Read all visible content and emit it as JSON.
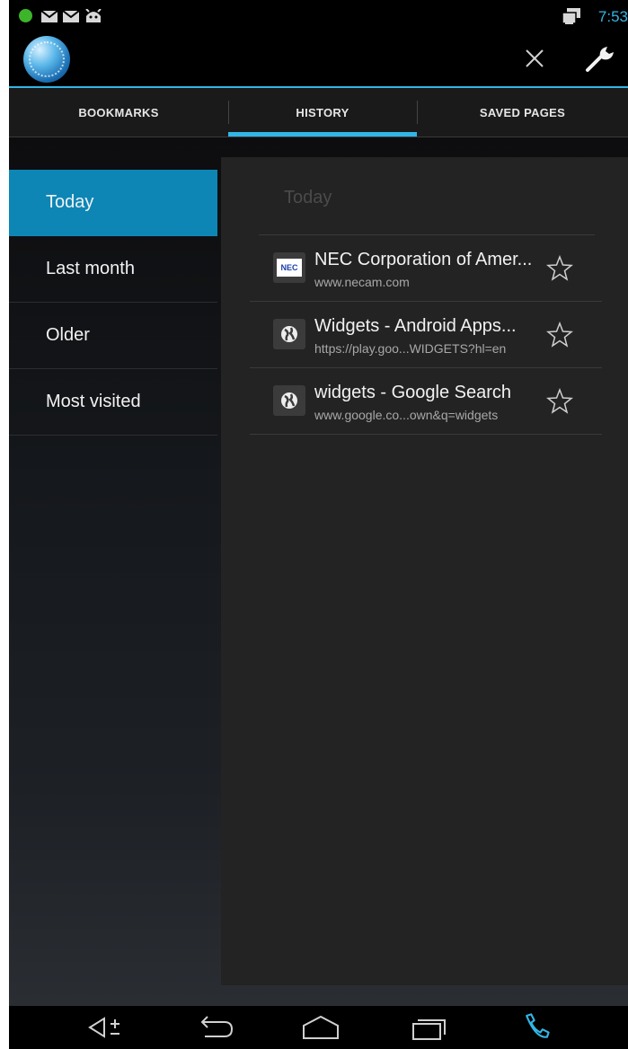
{
  "status_bar": {
    "time": "7:53",
    "icons": [
      "green-dot-icon",
      "mail-icon",
      "mail-icon",
      "android-icon",
      "window-icon"
    ]
  },
  "action_bar": {
    "logo": "globe-icon",
    "actions": [
      "close-icon",
      "wrench-icon"
    ]
  },
  "tabs": [
    {
      "label": "BOOKMARKS",
      "active": false
    },
    {
      "label": "HISTORY",
      "active": true
    },
    {
      "label": "SAVED PAGES",
      "active": false
    }
  ],
  "sidebar": {
    "items": [
      {
        "label": "Today",
        "selected": true
      },
      {
        "label": "Last month",
        "selected": false
      },
      {
        "label": "Older",
        "selected": false
      },
      {
        "label": "Most visited",
        "selected": false
      }
    ]
  },
  "history": {
    "section_title": "Today",
    "entries": [
      {
        "title": "NEC Corporation of Amer...",
        "url": "www.necam.com",
        "favicon": "NEC"
      },
      {
        "title": "Widgets - Android Apps...",
        "url": "https://play.goo...WIDGETS?hl=en",
        "favicon": "globe"
      },
      {
        "title": "widgets - Google Search",
        "url": "www.google.co...own&q=widgets",
        "favicon": "globe"
      }
    ]
  },
  "nav_bar": {
    "buttons": [
      "volume-icon",
      "back-icon",
      "home-icon",
      "recents-icon",
      "phone-icon"
    ]
  },
  "colors": {
    "accent": "#33b5e5",
    "selected_item": "#0d86b6",
    "panel": "#232323"
  }
}
